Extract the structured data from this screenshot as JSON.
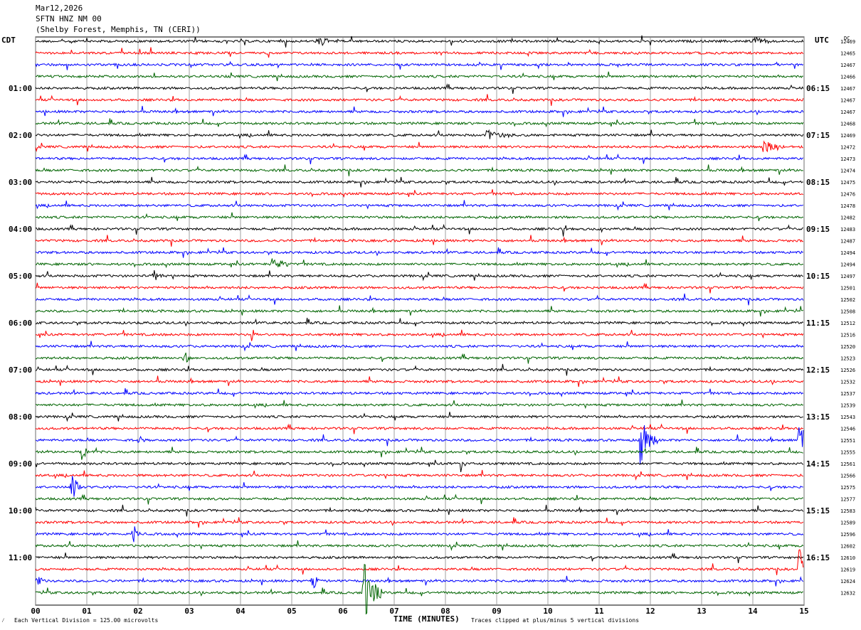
{
  "header": {
    "date": "Mar12,2026",
    "station": "SFTN HNZ NM 00",
    "location": "(Shelby Forest, Memphis, TN (CERI))"
  },
  "left_zone_label": "CDT",
  "right_zone_label": "UTC",
  "dc_label": "DC",
  "footer": {
    "scale_note": "Each Vertical Division = 125.00 microvolts",
    "clip_note": "Traces clipped at plus/minus 5 vertical divisions",
    "corner_mark": "⁄"
  },
  "colors": [
    "#000000",
    "#ff0000",
    "#0000ff",
    "#006400"
  ],
  "chart_data": {
    "type": "line",
    "title": "SFTN HNZ NM 00",
    "xlabel": "TIME (MINUTES)",
    "ylabel": "",
    "x_range": [
      0,
      15
    ],
    "x_ticks": [
      "00",
      "01",
      "02",
      "03",
      "04",
      "05",
      "06",
      "07",
      "08",
      "09",
      "10",
      "11",
      "12",
      "13",
      "14",
      "15"
    ],
    "grid": true,
    "trace_count": 48,
    "left_hour_labels": [
      "01:00",
      "02:00",
      "03:00",
      "04:00",
      "05:00",
      "06:00",
      "07:00",
      "08:00",
      "09:00",
      "10:00",
      "11:00"
    ],
    "right_hour_labels": [
      "06:15",
      "07:15",
      "08:15",
      "09:15",
      "10:15",
      "11:15",
      "12:15",
      "13:15",
      "14:15",
      "15:15",
      "16:15"
    ],
    "dc_offsets": [
      12469,
      12465,
      12467,
      12466,
      12467,
      12467,
      12467,
      12468,
      12469,
      12472,
      12473,
      12474,
      12475,
      12476,
      12478,
      12482,
      12483,
      12487,
      12494,
      12494,
      12497,
      12501,
      12502,
      12508,
      12512,
      12516,
      12520,
      12523,
      12526,
      12532,
      12537,
      12539,
      12543,
      12546,
      12551,
      12555,
      12561,
      12566,
      12575,
      12577,
      12583,
      12589,
      12596,
      12602,
      12610,
      12619,
      12624,
      12632
    ],
    "events": [
      {
        "trace": 0,
        "minute": 5.5,
        "amp": 9,
        "dur": 0.5
      },
      {
        "trace": 0,
        "minute": 14.0,
        "amp": 10,
        "dur": 0.4
      },
      {
        "trace": 9,
        "minute": 14.2,
        "amp": 12,
        "dur": 0.5
      },
      {
        "trace": 8,
        "minute": 8.8,
        "amp": 8,
        "dur": 0.6
      },
      {
        "trace": 16,
        "minute": 10.3,
        "amp": 14,
        "dur": 0.1
      },
      {
        "trace": 19,
        "minute": 4.6,
        "amp": 12,
        "dur": 0.4
      },
      {
        "trace": 20,
        "minute": 2.3,
        "amp": 10,
        "dur": 0.2
      },
      {
        "trace": 25,
        "minute": 4.2,
        "amp": 16,
        "dur": 0.15
      },
      {
        "trace": 27,
        "minute": 2.9,
        "amp": 18,
        "dur": 0.1
      },
      {
        "trace": 34,
        "minute": 11.8,
        "amp": 40,
        "dur": 0.35
      },
      {
        "trace": 34,
        "minute": 14.9,
        "amp": 30,
        "dur": 0.3
      },
      {
        "trace": 34,
        "minute": 2.0,
        "amp": 12,
        "dur": 0.15
      },
      {
        "trace": 35,
        "minute": 0.9,
        "amp": 12,
        "dur": 0.2
      },
      {
        "trace": 36,
        "minute": 8.3,
        "amp": 16,
        "dur": 0.1
      },
      {
        "trace": 38,
        "minute": 0.7,
        "amp": 22,
        "dur": 0.2
      },
      {
        "trace": 42,
        "minute": 1.9,
        "amp": 18,
        "dur": 0.15
      },
      {
        "trace": 46,
        "minute": 5.4,
        "amp": 22,
        "dur": 0.15
      },
      {
        "trace": 46,
        "minute": 0.0,
        "amp": 14,
        "dur": 0.2
      },
      {
        "trace": 47,
        "minute": 6.4,
        "amp": 50,
        "dur": 0.35
      },
      {
        "trace": 45,
        "minute": 14.9,
        "amp": 40,
        "dur": 0.15
      }
    ]
  }
}
